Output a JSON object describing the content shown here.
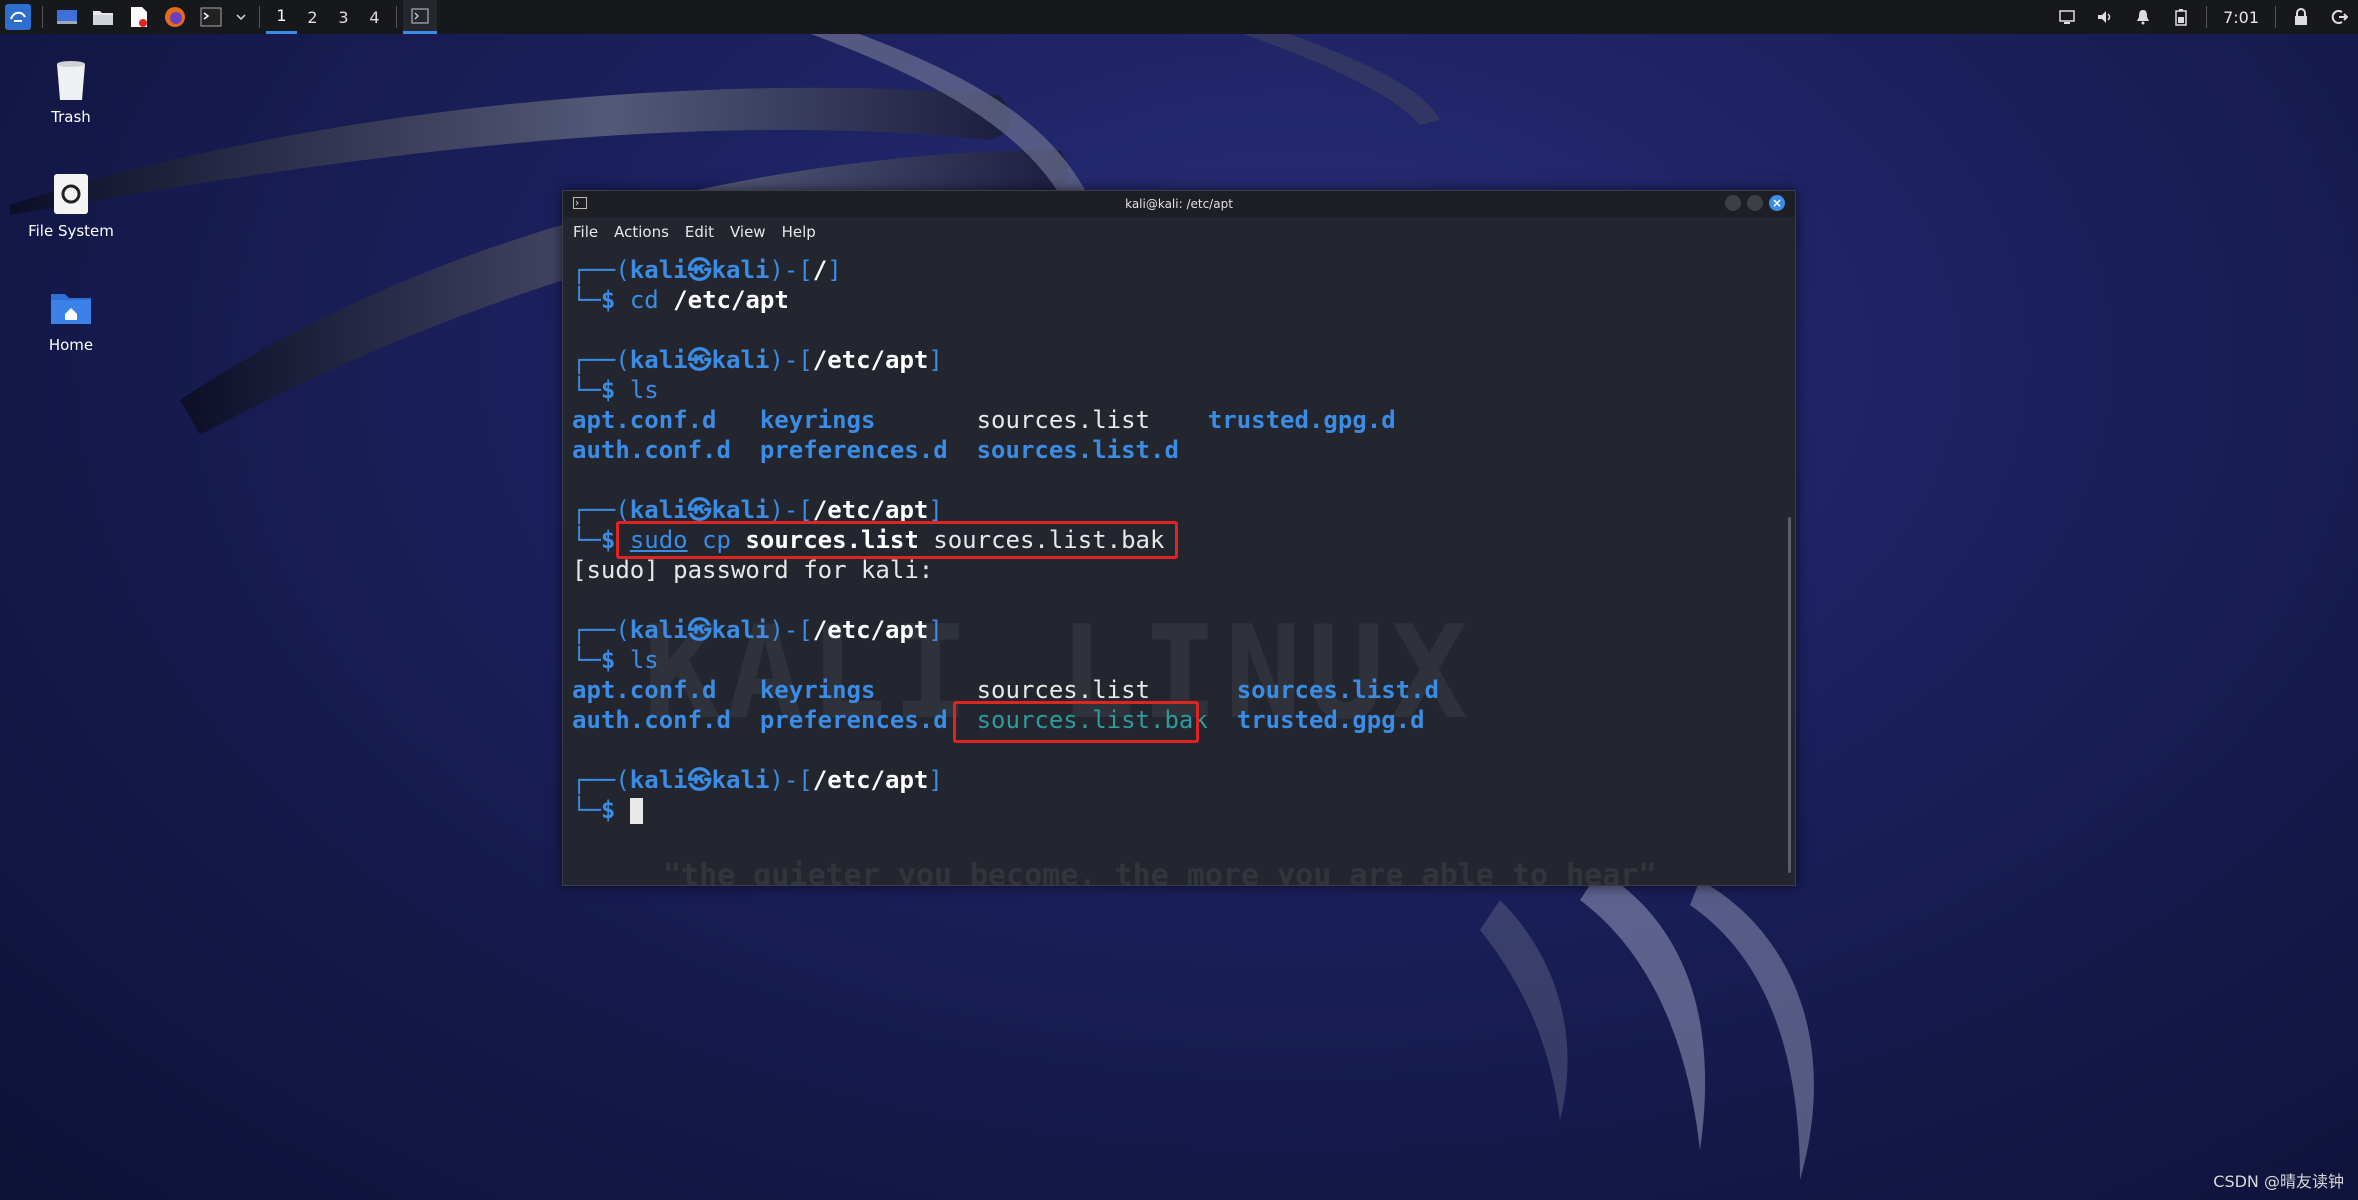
{
  "panel": {
    "workspaces": [
      "1",
      "2",
      "3",
      "4"
    ],
    "active_workspace": "1",
    "clock": "7:01",
    "icons": [
      "kali-menu-icon",
      "desktop-icon",
      "file-manager-icon",
      "text-editor-icon",
      "firefox-icon",
      "terminal-icon",
      "chevron-down-icon"
    ],
    "tray_icons": [
      "display-icon",
      "volume-icon",
      "notification-icon",
      "battery-icon",
      "lock-icon",
      "logout-icon"
    ]
  },
  "desktop": {
    "icons": [
      {
        "label": "Trash",
        "icon": "trash-icon"
      },
      {
        "label": "File System",
        "icon": "drive-icon"
      },
      {
        "label": "Home",
        "icon": "home-folder-icon"
      }
    ]
  },
  "terminal": {
    "title": "kali@kali: /etc/apt",
    "menu": [
      "File",
      "Actions",
      "Edit",
      "View",
      "Help"
    ],
    "prompt_user": "kali",
    "prompt_host": "kali",
    "prompt_sep": "㉿",
    "path_root": "/",
    "path_apt": "/etc/apt",
    "cmd_cd": "cd",
    "cmd_cd_arg": "/etc/apt",
    "cmd_ls": "ls",
    "ls1": {
      "row1": [
        "apt.conf.d",
        "keyrings",
        "sources.list",
        "trusted.gpg.d"
      ],
      "row2": [
        "auth.conf.d",
        "preferences.d",
        "sources.list.d"
      ]
    },
    "cmd_sudo": "sudo",
    "cmd_cp": "cp",
    "cp_src": "sources.list",
    "cp_dst": "sources.list.bak",
    "sudo_prompt": "[sudo] password for kali:",
    "ls2": {
      "row1": [
        "apt.conf.d",
        "keyrings",
        "sources.list",
        "sources.list.d"
      ],
      "row2": [
        "auth.conf.d",
        "preferences.d",
        "sources.list.bak",
        "trusted.gpg.d"
      ]
    },
    "watermark": "KALI LINUX",
    "quote": "\"the quieter you become, the more you are able to hear\""
  },
  "footer": {
    "watermark": "CSDN @晴友读钟"
  },
  "colors": {
    "accent": "#3a8ce4",
    "highlight": "#e0241f",
    "terminal_bg": "#23262e",
    "panel_bg": "#16181c"
  }
}
